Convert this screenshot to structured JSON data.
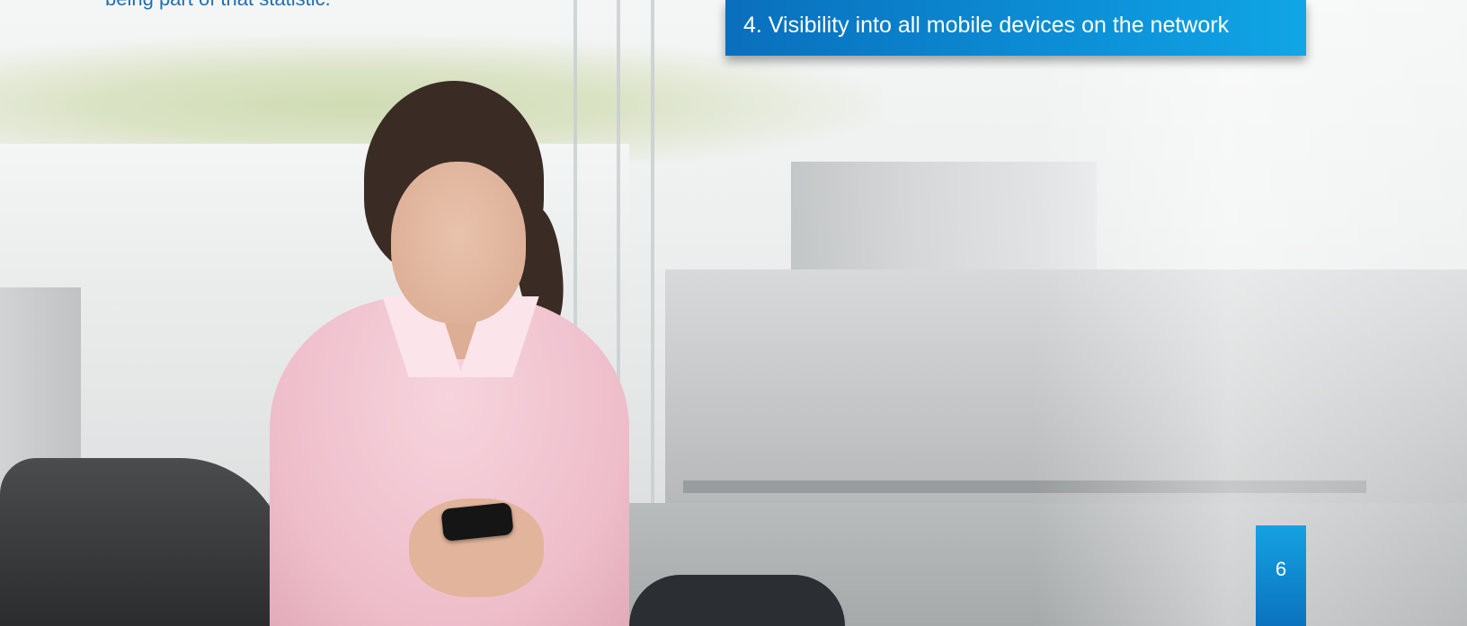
{
  "document": {
    "top_text": "being part of that statistic.",
    "callout": {
      "text": "4. Visibility into all mobile devices on the network",
      "color": "#0c8fd6"
    },
    "page_number": "6"
  },
  "image": {
    "subject": "photo"
  }
}
